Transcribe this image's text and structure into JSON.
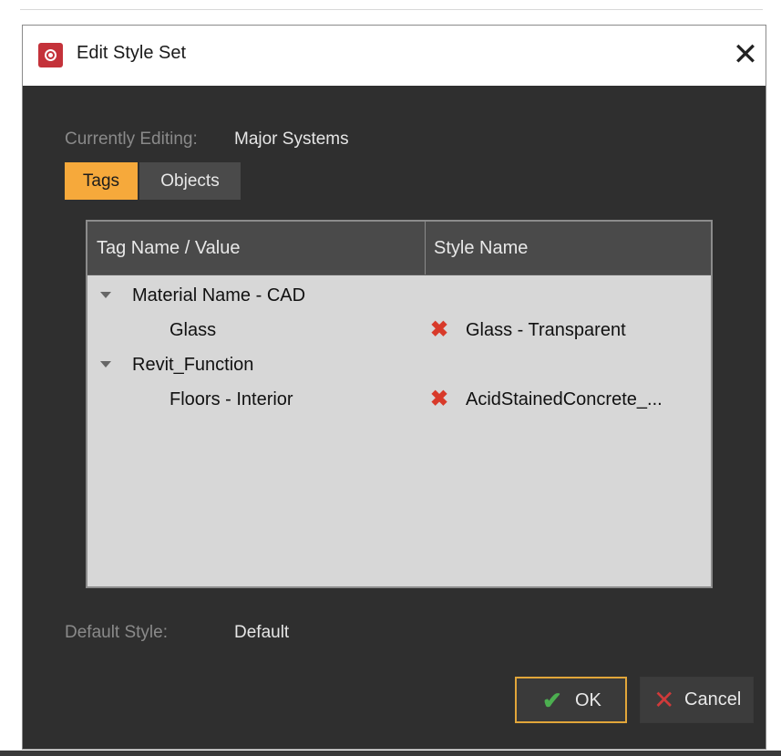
{
  "window": {
    "title": "Edit Style Set",
    "close_symbol": "✕"
  },
  "editing": {
    "label": "Currently Editing:",
    "value": "Major Systems"
  },
  "tabs": [
    {
      "label": "Tags",
      "active": true
    },
    {
      "label": "Objects",
      "active": false
    }
  ],
  "table": {
    "columns": [
      "Tag Name / Value",
      "Style Name"
    ],
    "rows": [
      {
        "type": "group",
        "label": "Material Name - CAD"
      },
      {
        "type": "item",
        "label": "Glass",
        "style": "Glass - Transparent",
        "remove_icon": "✖"
      },
      {
        "type": "group",
        "label": "Revit_Function"
      },
      {
        "type": "item",
        "label": "Floors - Interior",
        "style": "AcidStainedConcrete_...",
        "remove_icon": "✖"
      }
    ]
  },
  "default_style": {
    "label": "Default Style:",
    "value": "Default"
  },
  "buttons": {
    "ok": {
      "label": "OK",
      "icon": "check-icon",
      "symbol": "✔"
    },
    "cancel": {
      "label": "Cancel",
      "icon": "close-icon",
      "symbol": "✕"
    }
  },
  "colors": {
    "accent": "#f6a93b",
    "dialog_bg": "#2f2f2f",
    "table_bg": "#d7d7d7",
    "remove_icon": "#d83a2a",
    "ok_icon": "#4caf50"
  }
}
